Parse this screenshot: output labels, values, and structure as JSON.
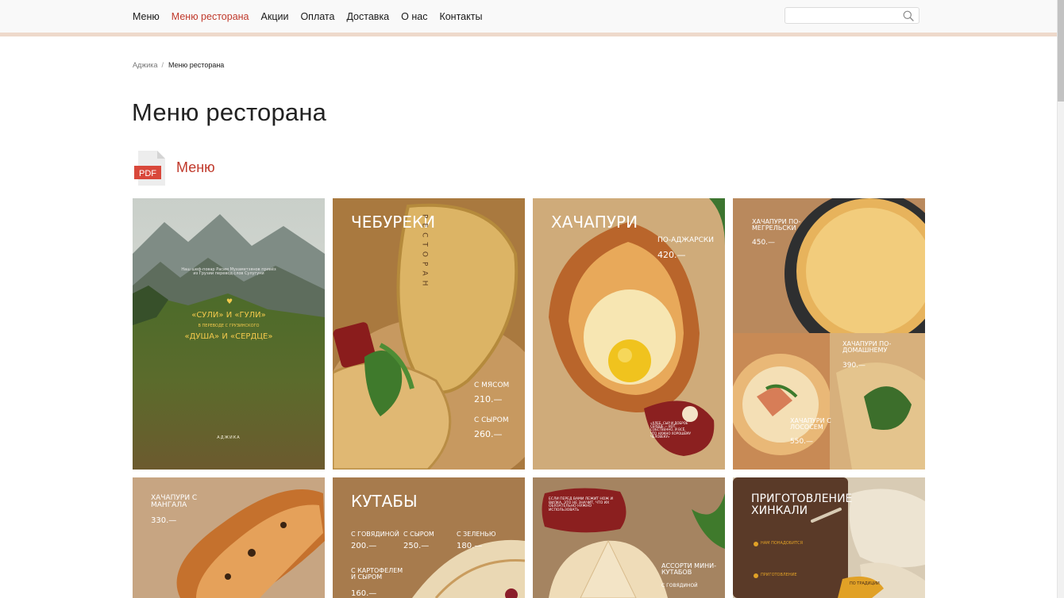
{
  "header": {
    "nav": [
      {
        "label": "Меню",
        "active": false
      },
      {
        "label": "Меню ресторана",
        "active": true
      },
      {
        "label": "Акции",
        "active": false
      },
      {
        "label": "Оплата",
        "active": false
      },
      {
        "label": "Доставка",
        "active": false
      },
      {
        "label": "О нас",
        "active": false
      },
      {
        "label": "Контакты",
        "active": false
      }
    ],
    "search": {
      "placeholder": "",
      "value": "",
      "icon": "search-icon"
    }
  },
  "breadcrumb": {
    "home": "Аджика",
    "separator": "/",
    "current": "Меню ресторана"
  },
  "page": {
    "title": "Меню ресторана"
  },
  "pdf": {
    "badge": "PDF",
    "label": "Меню",
    "icon": "pdf-file-icon"
  },
  "colors": {
    "accent": "#c0392b",
    "topbar": "#f9f9f9",
    "topbar_line": "#eed9cb"
  },
  "gallery": {
    "row1": [
      {
        "title": "«СУЛИ» И «ГУЛИ»",
        "sub": "В ПЕРЕВОДЕ С ГРУЗИНСКОГО",
        "title2": "«ДУША» И «СЕРДЦЕ»",
        "intro": "Наш шеф-повар Расим Мухаметзянов привёз из Грузии перевод слов Сулугуни",
        "logo": "АДЖИКА"
      },
      {
        "title": "ЧЕБУРЕКИ",
        "side": "РЕСТОРАН",
        "opt1": "С МЯСОМ",
        "price1": "210.—",
        "opt2": "С СЫРОМ",
        "price2": "260.—"
      },
      {
        "title": "ХАЧАПУРИ",
        "opt1": "ПО-АДЖАРСКИ",
        "price1": "420.—",
        "note": "«ХЛЕБ, СЫР И ДОБРОЕ СЕРДЦЕ — ВОТ, СОБСТВЕННО, И ВСЁ, ЧТО НУЖНО ХОРОШЕМУ ЧЕЛОВЕКУ»"
      },
      {
        "title": "ХАЧАПУРИ ПО-МЕГРЕЛЬСКИ",
        "price1": "450.—",
        "title2": "ХАЧАПУРИ ПО-ДОМАШНЕМУ",
        "price2": "390.—",
        "title3": "ХАЧАПУРИ С ЛОСОСЕМ",
        "price3": "550.—"
      }
    ],
    "row2": [
      {
        "title": "ХАЧАПУРИ С МАНГАЛА",
        "price1": "330.—"
      },
      {
        "title": "КУТАБЫ",
        "opt1": "С ГОВЯДИНОЙ",
        "price1": "200.—",
        "opt2": "С СЫРОМ",
        "price2": "250.—",
        "opt3": "С ЗЕЛЕНЬЮ",
        "price3": "180.—",
        "opt4": "С КАРТОФЕЛЕМ И СЫРОМ",
        "price4": "160.—"
      },
      {
        "note": "ЕСЛИ ПЕРЕД ВАМИ ЛЕЖИТ НОЖ И ВИЛКА, ЭТО НЕ ЗНАЧИТ, ЧТО ИХ ОБЯЗАТЕЛЬНО НУЖНО ИСПОЛЬЗОВАТЬ",
        "title": "АССОРТИ МИНИ-КУТАБОВ",
        "opt1": "С ГОВЯДИНОЙ"
      },
      {
        "title": "ПРИГОТОВЛЕНИЕ ХИНКАЛИ",
        "sub1": "НАМ ПОНАДОБИТСЯ",
        "sub2": "ПРИГОТОВЛЕНИЕ",
        "corner": "ПО ТРАДИЦИИ"
      }
    ]
  }
}
